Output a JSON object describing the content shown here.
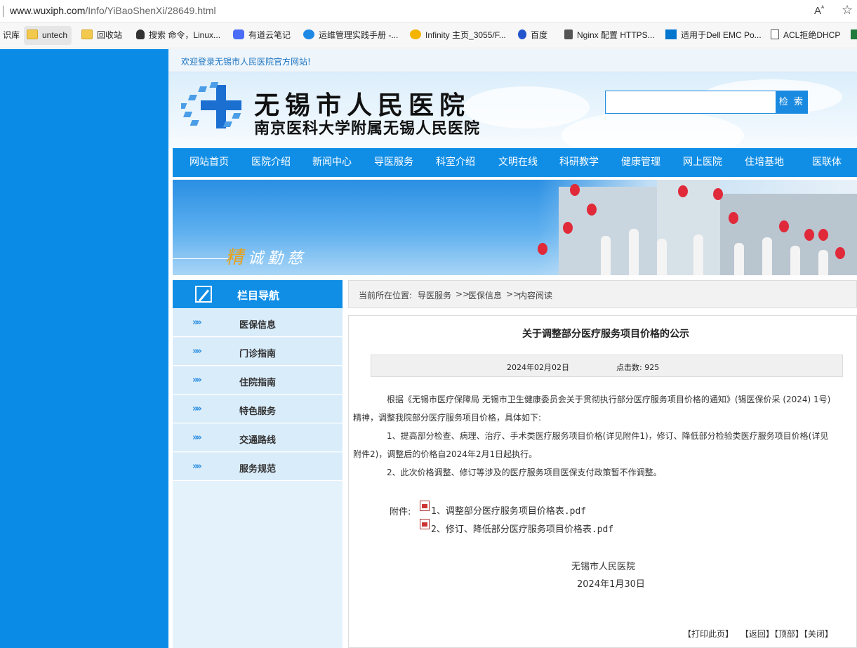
{
  "browser": {
    "url_host": "www.wuxiph.com",
    "url_path": "/Info/YiBaoShenXi/28649.html",
    "bookmarks": [
      {
        "label": "识库",
        "icon": "none"
      },
      {
        "label": "untech",
        "icon": "folder-icon"
      },
      {
        "label": "回收站",
        "icon": "folder-icon"
      },
      {
        "label": "搜索 命令，Linux...",
        "icon": "tux-icon"
      },
      {
        "label": "有道云笔记",
        "icon": "note-icon"
      },
      {
        "label": "运维管理实践手册 -...",
        "icon": "swirl-icon"
      },
      {
        "label": "Infinity 主页_3055/F...",
        "icon": "infinity-icon"
      },
      {
        "label": "百度",
        "icon": "paw-icon"
      },
      {
        "label": "Nginx 配置 HTTPS...",
        "icon": "nginx-icon"
      },
      {
        "label": "适用于Dell EMC Po...",
        "icon": "dell-icon"
      },
      {
        "label": "ACL拒绝DHCP",
        "icon": "doc-icon"
      }
    ]
  },
  "site": {
    "welcome": "欢迎登录无锡市人民医院官方网站!",
    "logo_title": "无锡市人民医院",
    "logo_subtitle": "南京医科大学附属无锡人民医院",
    "search_button": "检 索",
    "search_value": "",
    "nav": [
      "网站首页",
      "医院介绍",
      "新闻中心",
      "导医服务",
      "科室介绍",
      "文明在线",
      "科研教学",
      "健康管理",
      "网上医院",
      "住培基地",
      "医联体"
    ],
    "banner_slogan_first": "精",
    "banner_slogan_rest": "诚勤慈"
  },
  "sidebar": {
    "title": "栏目导航",
    "items": [
      "医保信息",
      "门诊指南",
      "住院指南",
      "特色服务",
      "交通路线",
      "服务规范"
    ]
  },
  "breadcrumb": {
    "prefix": "当前所在位置:",
    "l1": "导医服务",
    "sep": ">>",
    "l2": "医保信息",
    "l3": "内容阅读"
  },
  "article": {
    "title": "关于调整部分医疗服务项目价格的公示",
    "date": "2024年02月02日",
    "hits": "点击数: 925",
    "p1_line1": "根据《无锡市医疗保障局 无锡市卫生健康委员会关于贯彻执行部分医疗服务项目价格的通知》(锡医保价采 (2024) 1号)",
    "p1_line2": "精神，调整我院部分医疗服务项目价格，具体如下:",
    "p2_line1": "1、提高部分检查、病理、治疗、手术类医疗服务项目价格(详见附件1)，修订、降低部分检验类医疗服务项目价格(详见",
    "p2_line2": "附件2)，调整后的价格自2024年2月1日起执行。",
    "p3": "2、此次价格调整、修订等涉及的医疗服务项目医保支付政策暂不作调整。",
    "attach_label": "附件:",
    "attachments": [
      "1、调整部分医疗服务项目价格表.pdf",
      "2、修订、降低部分医疗服务项目价格表.pdf"
    ],
    "sign_org": "无锡市人民医院",
    "sign_date": "2024年1月30日",
    "footer_links": [
      "【打印此页】",
      "【返回】",
      "【顶部】",
      "【关闭】"
    ]
  }
}
